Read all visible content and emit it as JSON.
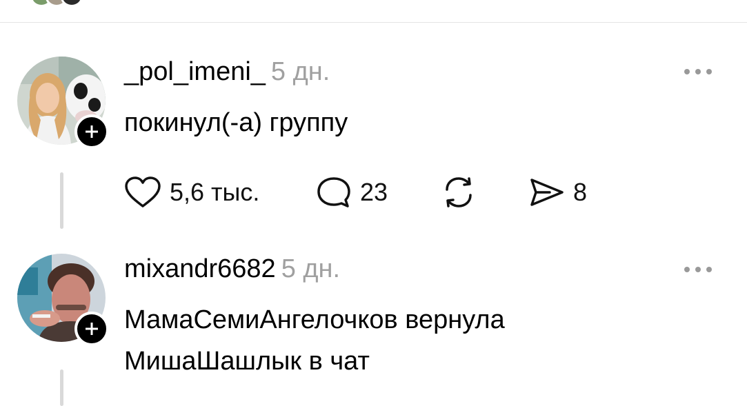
{
  "posts": [
    {
      "username": "_pol_imeni_",
      "time": "5 дн.",
      "text_lines": [
        "покинул(-а) группу"
      ],
      "likes": "5,6 тыс.",
      "comments": "23",
      "shares": "8",
      "icons": [
        "heart-icon",
        "comment-icon",
        "repost-icon",
        "send-icon",
        "more-icon",
        "plus-icon"
      ]
    },
    {
      "username": "mixandr6682",
      "time": "5 дн.",
      "text_lines": [
        "МамаСемиАнгелочков вернула",
        "МишаШашлык в чат"
      ],
      "icons": [
        "more-icon",
        "plus-icon"
      ]
    }
  ],
  "colors": {
    "text": "#000000",
    "muted": "#a0a0a0",
    "divider": "#e4e4e4",
    "thread_line": "#d9d9d9"
  }
}
